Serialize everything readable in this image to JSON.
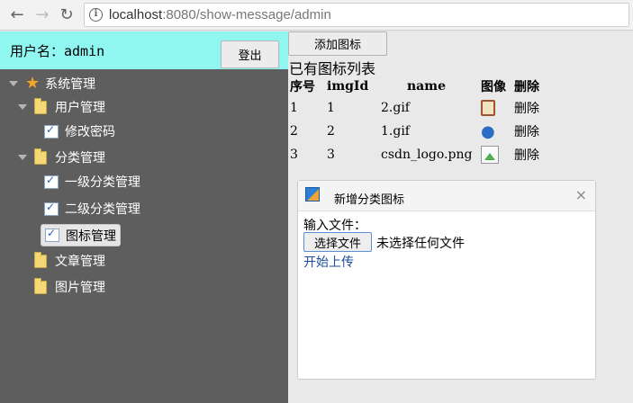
{
  "browser": {
    "url_host": "localhost",
    "url_rest": ":8080/show-message/admin",
    "back_glyph": "←",
    "forward_glyph": "→",
    "reload_glyph": "↻"
  },
  "header": {
    "username": "用户名：admin",
    "logout_label": "登出"
  },
  "tree": {
    "root": "系统管理",
    "items": [
      {
        "label": "用户管理"
      },
      {
        "label": "修改密码"
      },
      {
        "label": "分类管理"
      },
      {
        "label": "一级分类管理"
      },
      {
        "label": "二级分类管理"
      },
      {
        "label": "图标管理"
      },
      {
        "label": "文章管理"
      },
      {
        "label": "图片管理"
      }
    ]
  },
  "main": {
    "add_button": "添加图标",
    "list_title": "已有图标列表",
    "columns": [
      "序号",
      "imgId",
      "name",
      "图像",
      "删除"
    ],
    "rows": [
      {
        "index": "1",
        "imgId": "1",
        "name": "2.gif",
        "icon": "notepad-icon",
        "delete": "删除"
      },
      {
        "index": "2",
        "imgId": "2",
        "name": "1.gif",
        "icon": "map-pin-icon",
        "delete": "删除"
      },
      {
        "index": "3",
        "imgId": "3",
        "name": "csdn_logo.png",
        "icon": "broken-image-icon",
        "delete": "删除"
      }
    ]
  },
  "dialog": {
    "title": "新增分类图标",
    "close_glyph": "×",
    "file_label": "输入文件：",
    "file_button": "选择文件",
    "file_status": "未选择任何文件",
    "upload_link": "开始上传"
  },
  "colors": {
    "userbar": "#8ff6f0",
    "tree_bg": "#5e5e5e",
    "link": "#1a4d9e"
  }
}
